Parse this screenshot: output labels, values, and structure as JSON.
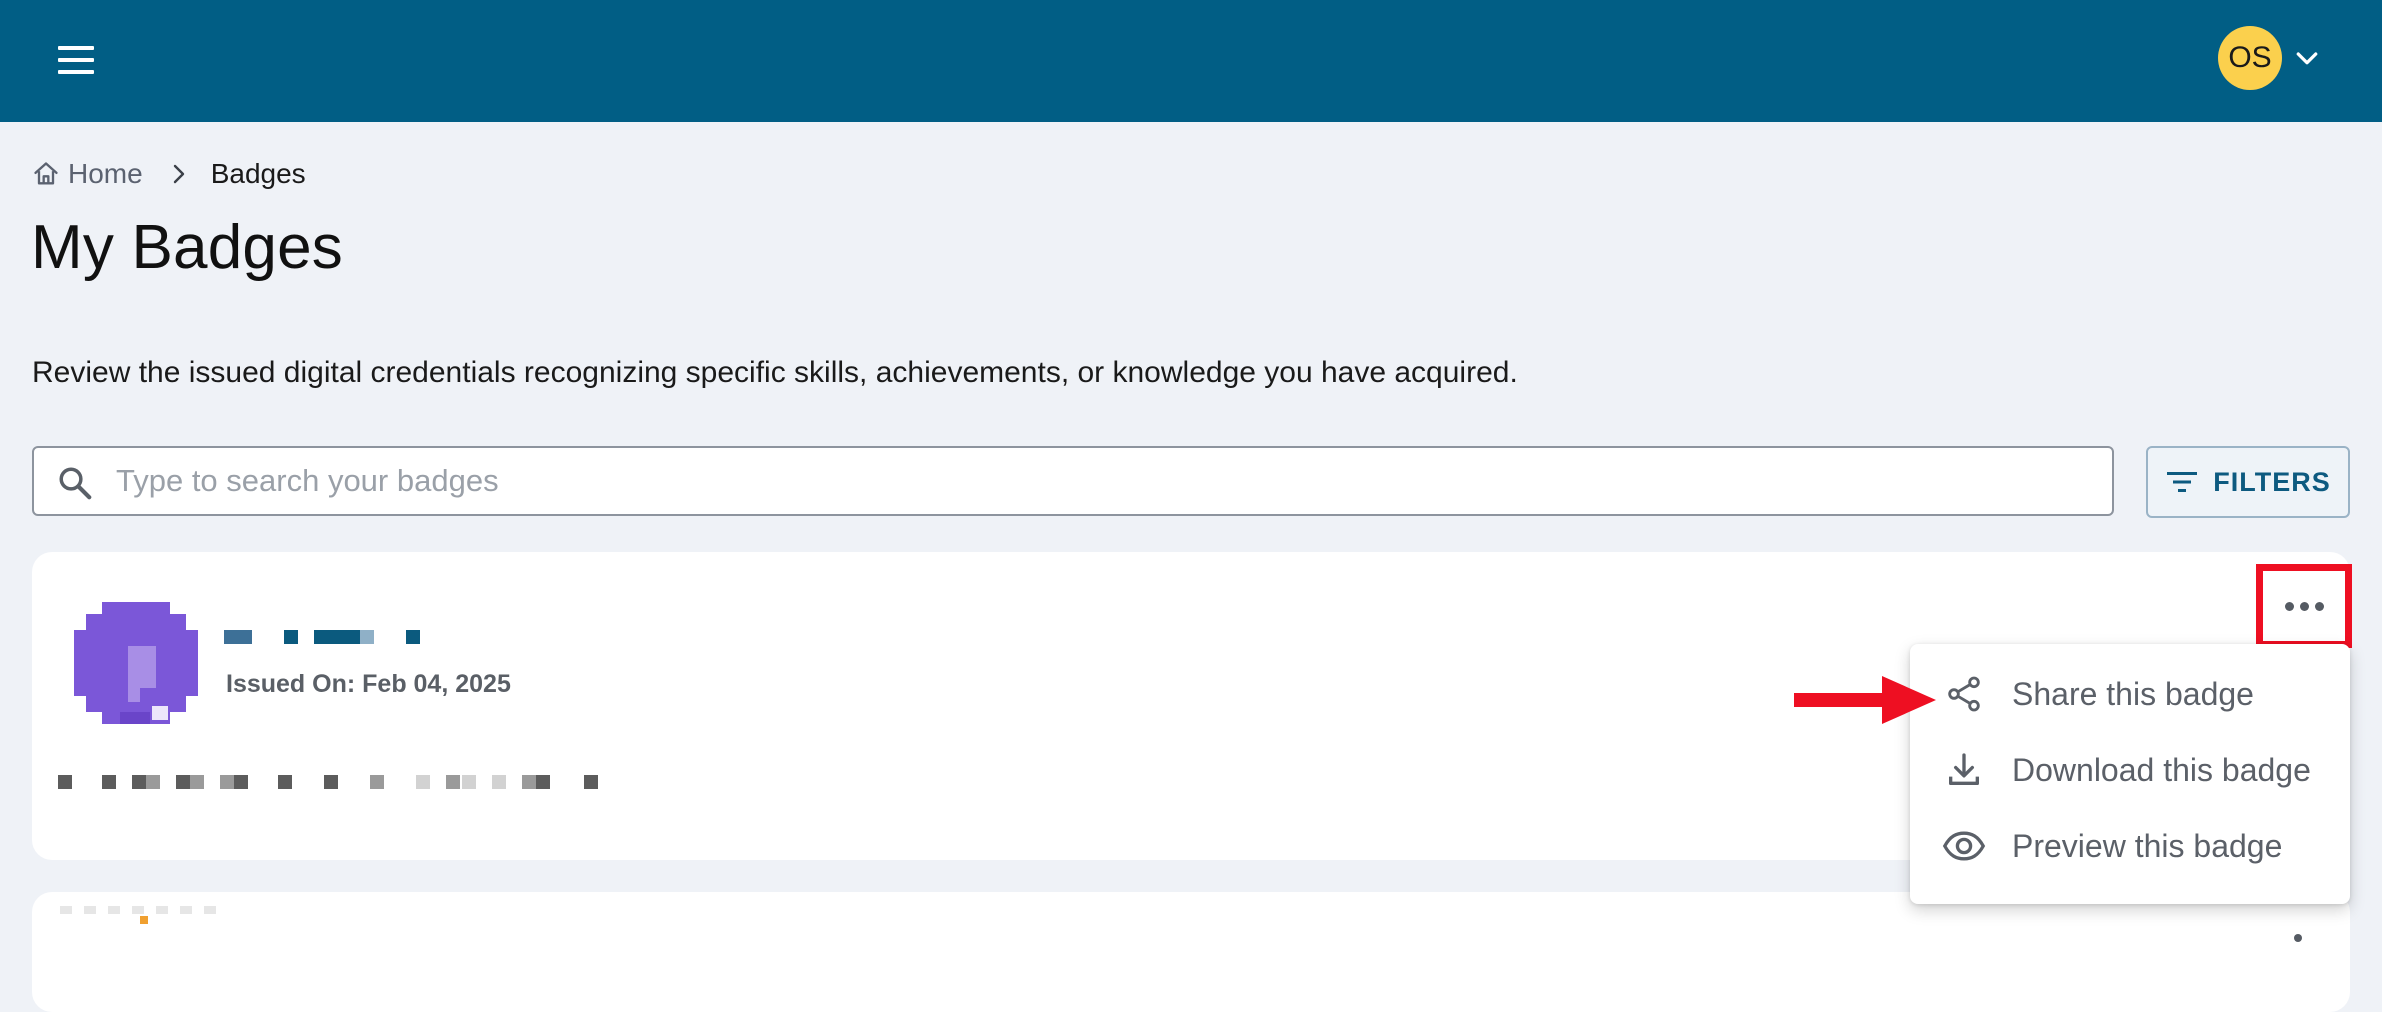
{
  "header": {
    "menu_icon": "hamburger-menu-icon",
    "avatar_initials": "OS",
    "avatar_color": "#fbd04d",
    "bar_color": "#015e85",
    "chevron_icon": "chevron-down-icon"
  },
  "breadcrumb": {
    "home_icon": "home-icon",
    "home_label": "Home",
    "separator_icon": "chevron-right-icon",
    "current_label": "Badges"
  },
  "page": {
    "title": "My Badges",
    "description": "Review the issued digital credentials recognizing specific skills, achievements, or knowledge you have acquired."
  },
  "search": {
    "icon": "search-icon",
    "placeholder": "Type to search your badges",
    "value": ""
  },
  "filters": {
    "icon": "filter-icon",
    "label": "FILTERS"
  },
  "badges": [
    {
      "issued_label": "Issued On:",
      "issued_date": "Feb 04, 2025",
      "badge_color": "#7b57d8",
      "actions_icon": "more-horizontal-icon"
    }
  ],
  "menu": {
    "items": [
      {
        "icon": "share-icon",
        "label": "Share this badge"
      },
      {
        "icon": "download-icon",
        "label": "Download this badge"
      },
      {
        "icon": "eye-icon",
        "label": "Preview this badge"
      }
    ]
  },
  "annotation": {
    "highlight_color": "#ee0f22"
  }
}
